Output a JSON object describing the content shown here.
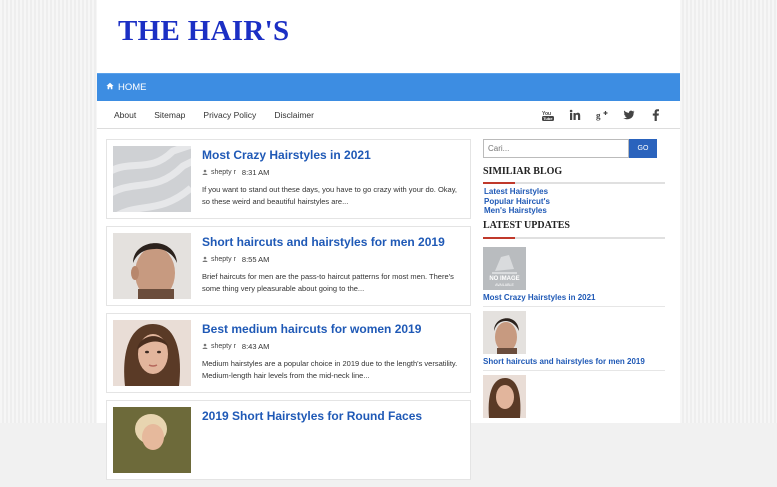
{
  "site": {
    "title": "THE HAIR'S"
  },
  "nav": {
    "home_label": "HOME"
  },
  "subnav": {
    "items": [
      "About",
      "Sitemap",
      "Privacy Policy",
      "Disclaimer"
    ]
  },
  "social": {
    "icons": [
      "youtube-icon",
      "linkedin-icon",
      "google-plus-icon",
      "twitter-icon",
      "facebook-icon"
    ]
  },
  "posts": [
    {
      "title": "Most Crazy Hairstyles in 2021",
      "author": "shepty r",
      "time": "8:31 AM",
      "excerpt": " If you want to stand out these days, you have to go crazy with your do. Okay, so these weird and beautiful hairstyles are..."
    },
    {
      "title": "Short haircuts and hairstyles for men 2019",
      "author": "shepty r",
      "time": "8:55 AM",
      "excerpt": "Brief haircuts for men are the pass-to haircut patterns for most men. There's some thing very pleasurable about going to the..."
    },
    {
      "title": "Best medium haircuts for women 2019",
      "author": "shepty r",
      "time": "8:43 AM",
      "excerpt": "Medium hairstyles are a popular choice in 2019 due to the length's versatility. Medium-length hair levels from the mid-neck line..."
    },
    {
      "title": "2019 Short Hairstyles for Round Faces",
      "author": "",
      "time": "",
      "excerpt": ""
    }
  ],
  "sidebar": {
    "search_placeholder": "Cari...",
    "search_button": "GO",
    "similar_title": "SIMILIAR BLOG",
    "similar_links": [
      "Latest Hairstyles",
      "Popular Haircut's",
      "Men's Hairstyles"
    ],
    "updates_title": "LATEST UPDATES",
    "updates": [
      {
        "title": "Most Crazy Hairstyles in 2021",
        "no_image_line1": "NO IMAGE",
        "no_image_line2": "AVAILABLE"
      },
      {
        "title": "Short haircuts and hairstyles for men 2019"
      },
      {
        "title": ""
      }
    ]
  },
  "colors": {
    "accent": "#3d8de2",
    "title": "#1b2fc4",
    "link": "#1f59b6",
    "rule": "#c0392b"
  }
}
